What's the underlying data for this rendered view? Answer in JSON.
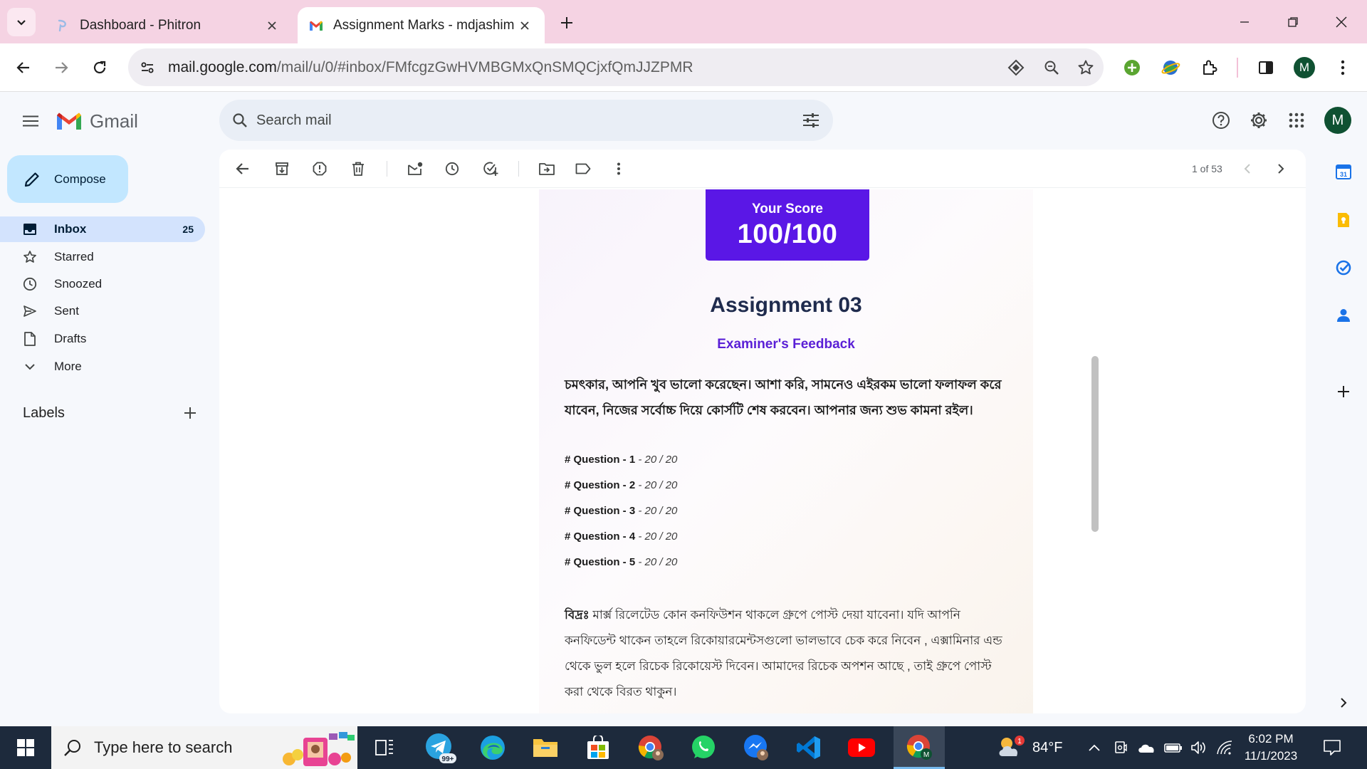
{
  "browser": {
    "tabs": [
      {
        "title": "Dashboard - Phitron",
        "active": false
      },
      {
        "title": "Assignment Marks - mdjashim",
        "active": true
      }
    ],
    "url_host": "mail.google.com",
    "url_path": "/mail/u/0/#inbox/FMfcgzGwHVMBGMxQnSMQCjxfQmJJZPMR",
    "profile_initial": "M"
  },
  "gmail": {
    "app_name": "Gmail",
    "search_placeholder": "Search mail",
    "avatar_initial": "M",
    "compose_label": "Compose",
    "nav": [
      {
        "label": "Inbox",
        "count": "25",
        "icon": "inbox-icon"
      },
      {
        "label": "Starred",
        "count": "",
        "icon": "star-icon"
      },
      {
        "label": "Snoozed",
        "count": "",
        "icon": "clock-icon"
      },
      {
        "label": "Sent",
        "count": "",
        "icon": "send-icon"
      },
      {
        "label": "Drafts",
        "count": "",
        "icon": "draft-icon"
      },
      {
        "label": "More",
        "count": "",
        "icon": "chevron-down-icon"
      }
    ],
    "labels_heading": "Labels",
    "pager": "1 of 53"
  },
  "email": {
    "score_label": "Your Score",
    "score_value": "100/100",
    "assignment_title": "Assignment 03",
    "feedback_title": "Examiner's Feedback",
    "feedback_body": "চমৎকার, আপনি খুব ভালো করেছেন। আশা করি, সামনেও এইরকম ভালো ফলাফল করে যাবেন, নিজের সর্বোচ্চ দিয়ে কোর্সটি শেষ করবেন। আপনার জন্য শুভ কামনা রইল।",
    "questions": [
      {
        "name": "# Question - 1",
        "marks": " - 20 / 20"
      },
      {
        "name": "# Question - 2",
        "marks": " - 20 / 20"
      },
      {
        "name": "# Question - 3",
        "marks": " - 20 / 20"
      },
      {
        "name": "# Question - 4",
        "marks": " - 20 / 20"
      },
      {
        "name": "# Question - 5",
        "marks": " - 20 / 20"
      }
    ],
    "note_label": "বিদ্রঃ",
    "note_text": " মার্ক্স রিলেটেড কোন কনফিউশন থাকলে গ্রুপে পোস্ট দেয়া যাবেনা। যদি আপনি কনফিডেন্ট থাকেন তাহলে রিকোয়ারমেন্টসগুলো ভালভাবে চেক করে নিবেন , এক্সামিনার এন্ড থেকে ভুল হলে রিচেক রিকোয়েস্ট দিবেন। আমাদের রিচেক অপশন আছে , তাই গ্রুপে পোস্ট করা থেকে বিরত থাকুন।"
  },
  "taskbar": {
    "search_placeholder": "Type here to search",
    "telegram_badge": "99+",
    "weather_badge": "1",
    "temperature": "84°F",
    "time": "6:02 PM",
    "date": "11/1/2023"
  },
  "colors": {
    "score_bg": "#5a17e6",
    "feedback_title": "#5a1fd6",
    "inbox_active": "#d3e3fd",
    "compose_bg": "#c2e7ff",
    "tabstrip_bg": "#f5d3e3",
    "taskbar_bg": "#1d2a3c"
  }
}
